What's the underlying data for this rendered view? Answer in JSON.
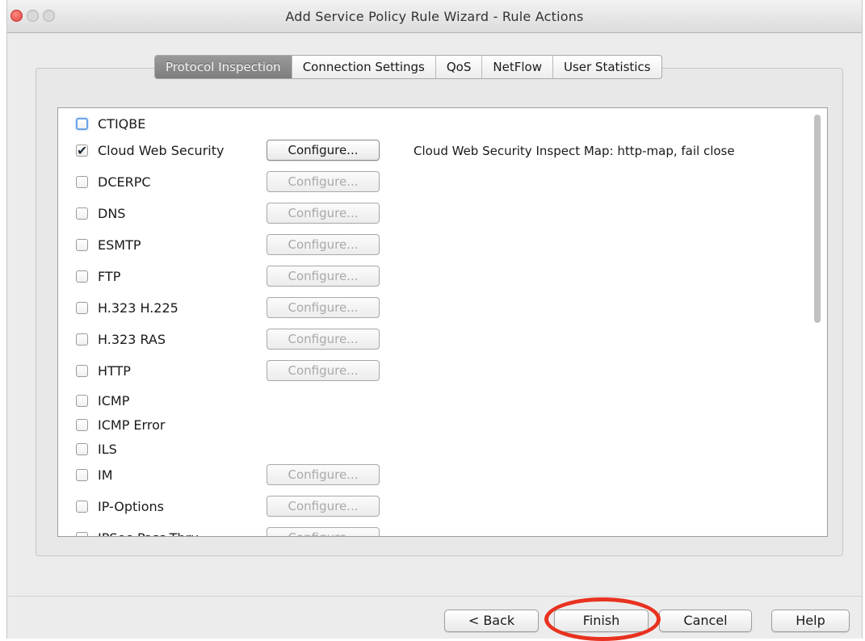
{
  "window": {
    "title": "Add Service Policy Rule Wizard - Rule Actions"
  },
  "tabs": [
    {
      "label": "Protocol Inspection",
      "active": true
    },
    {
      "label": "Connection Settings",
      "active": false
    },
    {
      "label": "QoS",
      "active": false
    },
    {
      "label": "NetFlow",
      "active": false
    },
    {
      "label": "User Statistics",
      "active": false
    }
  ],
  "configure_label": "Configure...",
  "inspections": [
    {
      "name": "CTIQBE",
      "checked": false,
      "configure": false,
      "focused": true
    },
    {
      "name": "Cloud Web Security",
      "checked": true,
      "configure": true,
      "configure_enabled": true,
      "description": "Cloud Web Security Inspect Map: http-map, fail close"
    },
    {
      "name": "DCERPC",
      "checked": false,
      "configure": true
    },
    {
      "name": "DNS",
      "checked": false,
      "configure": true
    },
    {
      "name": "ESMTP",
      "checked": false,
      "configure": true
    },
    {
      "name": "FTP",
      "checked": false,
      "configure": true
    },
    {
      "name": "H.323 H.225",
      "checked": false,
      "configure": true
    },
    {
      "name": "H.323 RAS",
      "checked": false,
      "configure": true
    },
    {
      "name": "HTTP",
      "checked": false,
      "configure": true
    },
    {
      "name": "ICMP",
      "checked": false,
      "configure": false
    },
    {
      "name": "ICMP Error",
      "checked": false,
      "configure": false
    },
    {
      "name": "ILS",
      "checked": false,
      "configure": false
    },
    {
      "name": "IM",
      "checked": false,
      "configure": true
    },
    {
      "name": "IP-Options",
      "checked": false,
      "configure": true
    },
    {
      "name": "IPSec-Pass-Thru",
      "checked": false,
      "configure": true
    }
  ],
  "buttons": {
    "back": "< Back",
    "finish": "Finish",
    "cancel": "Cancel",
    "help": "Help"
  },
  "colors": {
    "highlight_ring": "#e8321f",
    "active_tab": "#8a8a8a"
  }
}
